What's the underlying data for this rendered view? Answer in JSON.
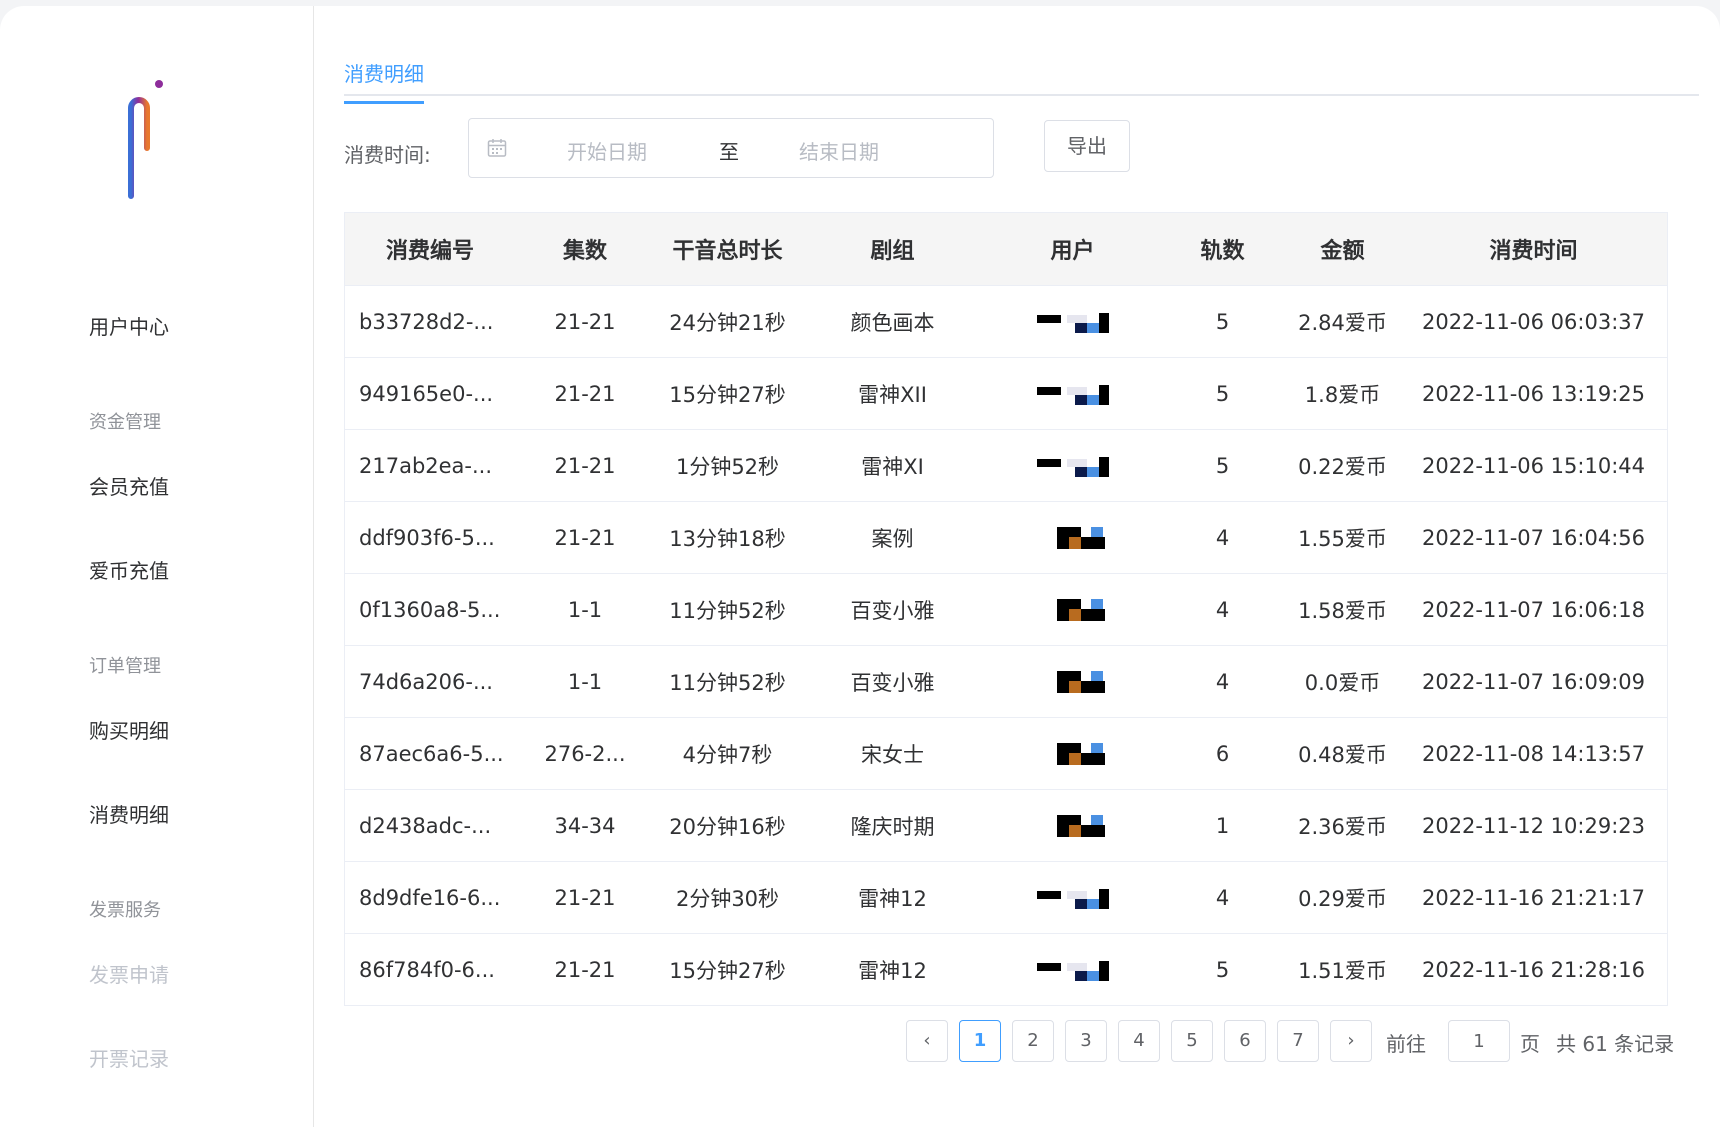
{
  "sidebar": {
    "items": [
      {
        "label": "用户中心",
        "type": "item"
      },
      {
        "label": "资金管理",
        "type": "group"
      },
      {
        "label": "会员充值",
        "type": "item"
      },
      {
        "label": "爱币充值",
        "type": "item"
      },
      {
        "label": "订单管理",
        "type": "group"
      },
      {
        "label": "购买明细",
        "type": "item"
      },
      {
        "label": "消费明细",
        "type": "item"
      },
      {
        "label": "发票服务",
        "type": "group"
      },
      {
        "label": "发票申请",
        "type": "item"
      },
      {
        "label": "开票记录",
        "type": "item"
      }
    ]
  },
  "tab": {
    "label": "消费明细"
  },
  "filter": {
    "label": "消费时间:",
    "start_placeholder": "开始日期",
    "separator": "至",
    "end_placeholder": "结束日期",
    "export_label": "导出"
  },
  "table": {
    "headers": [
      "消费编号",
      "集数",
      "干音总时长",
      "剧组",
      "用户",
      "轨数",
      "金额",
      "消费时间"
    ],
    "rows": [
      {
        "id": "b33728d2-...",
        "episodes": "21-21",
        "duration": "24分钟21秒",
        "group": "颜色画本",
        "tracks": "5",
        "amount": "2.84爱币",
        "time": "2022-11-06 06:03:37"
      },
      {
        "id": "949165e0-...",
        "episodes": "21-21",
        "duration": "15分钟27秒",
        "group": "雷神XII",
        "tracks": "5",
        "amount": "1.8爱币",
        "time": "2022-11-06 13:19:25"
      },
      {
        "id": "217ab2ea-...",
        "episodes": "21-21",
        "duration": "1分钟52秒",
        "group": "雷神XI",
        "tracks": "5",
        "amount": "0.22爱币",
        "time": "2022-11-06 15:10:44"
      },
      {
        "id": "ddf903f6-5...",
        "episodes": "21-21",
        "duration": "13分钟18秒",
        "group": "案例",
        "tracks": "4",
        "amount": "1.55爱币",
        "time": "2022-11-07 16:04:56"
      },
      {
        "id": "0f1360a8-5...",
        "episodes": "1-1",
        "duration": "11分钟52秒",
        "group": "百变小雅",
        "tracks": "4",
        "amount": "1.58爱币",
        "time": "2022-11-07 16:06:18"
      },
      {
        "id": "74d6a206-...",
        "episodes": "1-1",
        "duration": "11分钟52秒",
        "group": "百变小雅",
        "tracks": "4",
        "amount": "0.0爱币",
        "time": "2022-11-07 16:09:09"
      },
      {
        "id": "87aec6a6-5...",
        "episodes": "276-2...",
        "duration": "4分钟7秒",
        "group": "宋女士",
        "tracks": "6",
        "amount": "0.48爱币",
        "time": "2022-11-08 14:13:57"
      },
      {
        "id": "d2438adc-...",
        "episodes": "34-34",
        "duration": "20分钟16秒",
        "group": "隆庆时期",
        "tracks": "1",
        "amount": "2.36爱币",
        "time": "2022-11-12 10:29:23"
      },
      {
        "id": "8d9dfe16-6...",
        "episodes": "21-21",
        "duration": "2分钟30秒",
        "group": "雷神12",
        "tracks": "4",
        "amount": "0.29爱币",
        "time": "2022-11-16 21:21:17"
      },
      {
        "id": "86f784f0-6...",
        "episodes": "21-21",
        "duration": "15分钟27秒",
        "group": "雷神12",
        "tracks": "5",
        "amount": "1.51爱币",
        "time": "2022-11-16 21:28:16"
      }
    ]
  },
  "pagination": {
    "prev": "‹",
    "next": "›",
    "pages": [
      "1",
      "2",
      "3",
      "4",
      "5",
      "6",
      "7"
    ],
    "current": "1",
    "goto_label": "前往",
    "goto_value": "1",
    "page_unit": "页",
    "total_text": "共 61 条记录"
  }
}
